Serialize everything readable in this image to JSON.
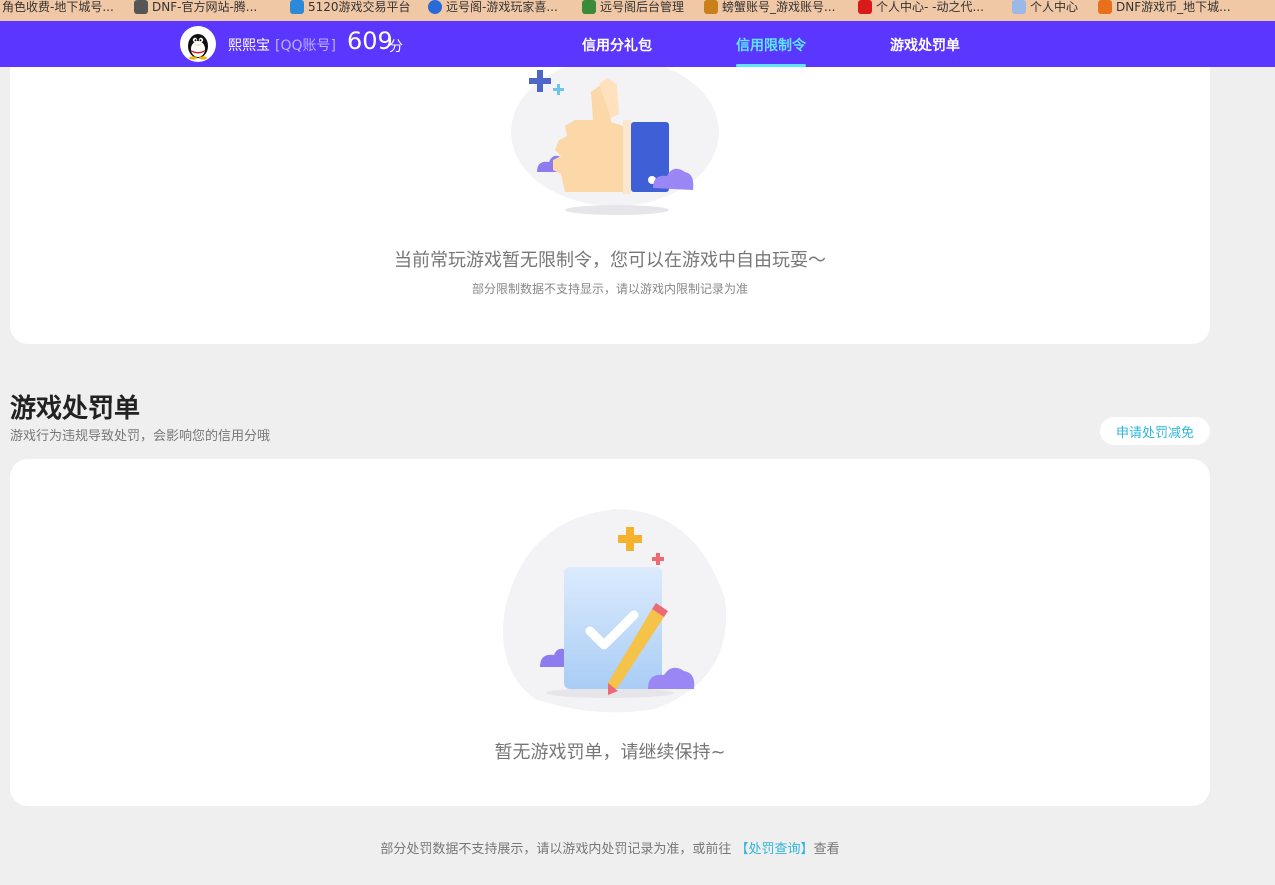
{
  "bookmarks": [
    {
      "label": "角色收费-地下城号...",
      "color": "#8a4a2a"
    },
    {
      "label": "DNF-官方网站-腾...",
      "color": "#555555"
    },
    {
      "label": "5120游戏交易平台",
      "color": "#2a8ad8"
    },
    {
      "label": "远号阁-游戏玩家喜...",
      "color": "#2a6ad8"
    },
    {
      "label": "远号阁后台管理",
      "color": "#3a8a3a"
    },
    {
      "label": "螃蟹账号_游戏账号...",
      "color": "#c8801a"
    },
    {
      "label": "个人中心- -动之代...",
      "color": "#d81a1a"
    },
    {
      "label": "个人中心",
      "color": "#2a6ad8"
    },
    {
      "label": "DNF游戏币_地下城...",
      "color": "#e8701a"
    }
  ],
  "header": {
    "username": "熙熙宝",
    "account_type": "[QQ账号]",
    "score": "609",
    "score_unit": "分",
    "nav": [
      {
        "label": "信用分礼包",
        "active": false
      },
      {
        "label": "信用限制令",
        "active": true
      },
      {
        "label": "游戏处罚单",
        "active": false
      }
    ]
  },
  "restriction": {
    "message": "当前常玩游戏暂无限制令，您可以在游戏中自由玩耍～",
    "sub": "部分限制数据不支持显示，请以游戏内限制记录为准"
  },
  "penalty": {
    "title": "游戏处罚单",
    "desc": "游戏行为违规导致处罚，会影响您的信用分哦",
    "apply_label": "申请处罚减免",
    "message": "暂无游戏罚单，请继续保持~"
  },
  "footer": {
    "text_before": "部分处罚数据不支持展示，请以游戏内处罚记录为准，或前往 ",
    "link": "【处罚查询】",
    "text_after": "查看"
  },
  "colors": {
    "header_bg": "#5a36ff",
    "active_nav": "#5ee5ff",
    "link": "#2fb6d8",
    "page_bg": "#efefef"
  }
}
